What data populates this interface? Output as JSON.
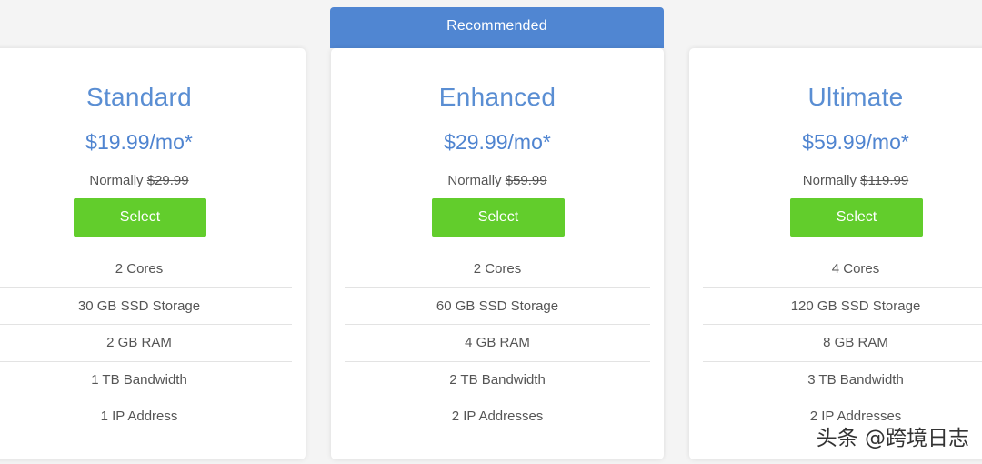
{
  "banner": {
    "label": "Recommended"
  },
  "plans": [
    {
      "name": "Standard",
      "price": "$19.99/mo*",
      "normally_prefix": "Normally",
      "normally_price": "$29.99",
      "select_label": "Select",
      "features": [
        "2 Cores",
        "30 GB SSD Storage",
        "2 GB RAM",
        "1 TB Bandwidth",
        "1 IP Address"
      ]
    },
    {
      "name": "Enhanced",
      "price": "$29.99/mo*",
      "normally_prefix": "Normally",
      "normally_price": "$59.99",
      "select_label": "Select",
      "features": [
        "2 Cores",
        "60 GB SSD Storage",
        "4 GB RAM",
        "2 TB Bandwidth",
        "2 IP Addresses"
      ]
    },
    {
      "name": "Ultimate",
      "price": "$59.99/mo*",
      "normally_prefix": "Normally",
      "normally_price": "$119.99",
      "select_label": "Select",
      "features": [
        "4 Cores",
        "120 GB SSD Storage",
        "8 GB RAM",
        "3 TB Bandwidth",
        "2 IP Addresses"
      ]
    }
  ],
  "watermark": {
    "text": "头条 @跨境日志"
  },
  "colors": {
    "accent_blue": "#5a8ed3",
    "banner_blue": "#5086d2",
    "select_green": "#62cd2c"
  }
}
